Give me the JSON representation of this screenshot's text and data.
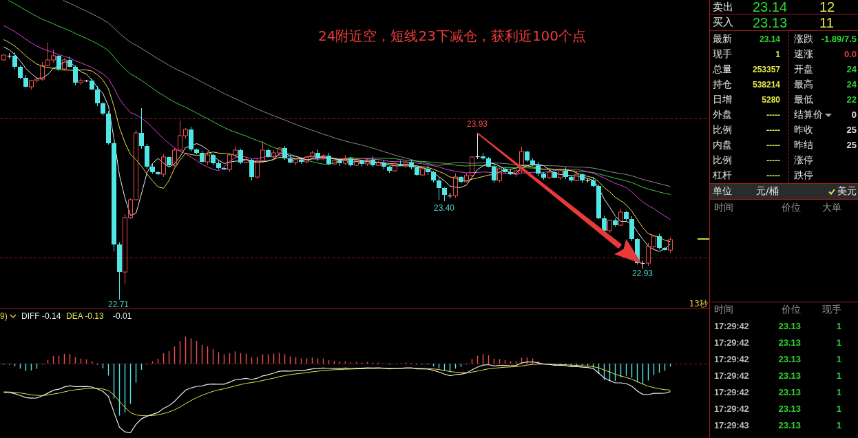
{
  "price_chart": {
    "annotation": "24附近空，短线23下减仓，获利近100个点",
    "price_labels": [
      {
        "text": "23.93",
        "kind": "high"
      },
      {
        "text": "23.40",
        "kind": "low"
      },
      {
        "text": "22.93",
        "kind": "low"
      },
      {
        "text": "22.71",
        "kind": "low"
      }
    ],
    "countdown": "13秒"
  },
  "macd": {
    "parameters": "9)",
    "diff": "DIFF -0.14",
    "dea": "DEA -0.13",
    "macd": "-0.01"
  },
  "quote": {
    "ask": {
      "label": "卖出",
      "price": "23.14",
      "volume": "12"
    },
    "bid": {
      "label": "买入",
      "price": "23.13",
      "volume": "11"
    }
  },
  "stats": [
    {
      "left": {
        "label": "最新",
        "value": "23.14",
        "color": "#2ed42e"
      },
      "right": {
        "label": "涨跌",
        "value": "-1.89/7.5",
        "color": "#2ed42e",
        "kind": "plain"
      }
    },
    {
      "left": {
        "label": "现手",
        "value": "1",
        "color": "#e6e64a"
      },
      "right": {
        "label": "速涨",
        "value": "0.0",
        "color": "#e83c3c",
        "kind": "plain"
      }
    },
    {
      "left": {
        "label": "总量",
        "value": "253357",
        "color": "#e6e64a"
      },
      "right": {
        "label": "开盘",
        "value": "24",
        "color": "#2ed42e",
        "kind": "plain"
      }
    },
    {
      "left": {
        "label": "持仓",
        "value": "538214",
        "color": "#e6e64a"
      },
      "right": {
        "label": "最高",
        "value": "24",
        "color": "#2ed42e",
        "kind": "plain"
      }
    },
    {
      "left": {
        "label": "日增",
        "value": "5280",
        "color": "#e6e64a"
      },
      "right": {
        "label": "最低",
        "value": "22",
        "color": "#2ed42e",
        "kind": "plain"
      }
    },
    {
      "left": {
        "label": "外盘",
        "value": "-----",
        "color": "#e6e64a"
      },
      "right": {
        "label": "结算价",
        "value": "0",
        "color": "#e0e0e0",
        "kind": "dropdown"
      }
    },
    {
      "left": {
        "label": "比例",
        "value": "-----",
        "color": "#e6e64a"
      },
      "right": {
        "label": "昨收",
        "value": "25",
        "color": "#e0e0e0",
        "kind": "plain"
      }
    },
    {
      "left": {
        "label": "内盘",
        "value": "-----",
        "color": "#e6e64a"
      },
      "right": {
        "label": "昨结",
        "value": "25",
        "color": "#e0e0e0",
        "kind": "plain"
      }
    },
    {
      "left": {
        "label": "比例",
        "value": "-----",
        "color": "#e6e64a"
      },
      "right": {
        "label": "涨停",
        "kind": "plain"
      }
    },
    {
      "left": {
        "label": "杠杆",
        "value": "-----",
        "color": "#e6e64a"
      },
      "right": {
        "label": "跌停",
        "kind": "plain"
      }
    }
  ],
  "unit": {
    "label": "单位",
    "value": "元/桶",
    "option": {
      "label": "美元",
      "checked": true
    }
  },
  "big_orders": {
    "columns": [
      "时间",
      "价位",
      "大单"
    ]
  },
  "trades": {
    "columns": [
      "时间",
      "价位",
      "现手"
    ],
    "rows": [
      {
        "time": "17:29:42",
        "price": "23.13",
        "volume": "1"
      },
      {
        "time": "17:29:42",
        "price": "23.13",
        "volume": "1"
      },
      {
        "time": "17:29:42",
        "price": "23.13",
        "volume": "1"
      },
      {
        "time": "17:29:42",
        "price": "23.13",
        "volume": "1"
      },
      {
        "time": "17:29:42",
        "price": "23.13",
        "volume": "1"
      },
      {
        "time": "17:29:42",
        "price": "23.13",
        "volume": "1"
      },
      {
        "time": "17:29:43",
        "price": "23.13",
        "volume": "1"
      }
    ]
  }
}
